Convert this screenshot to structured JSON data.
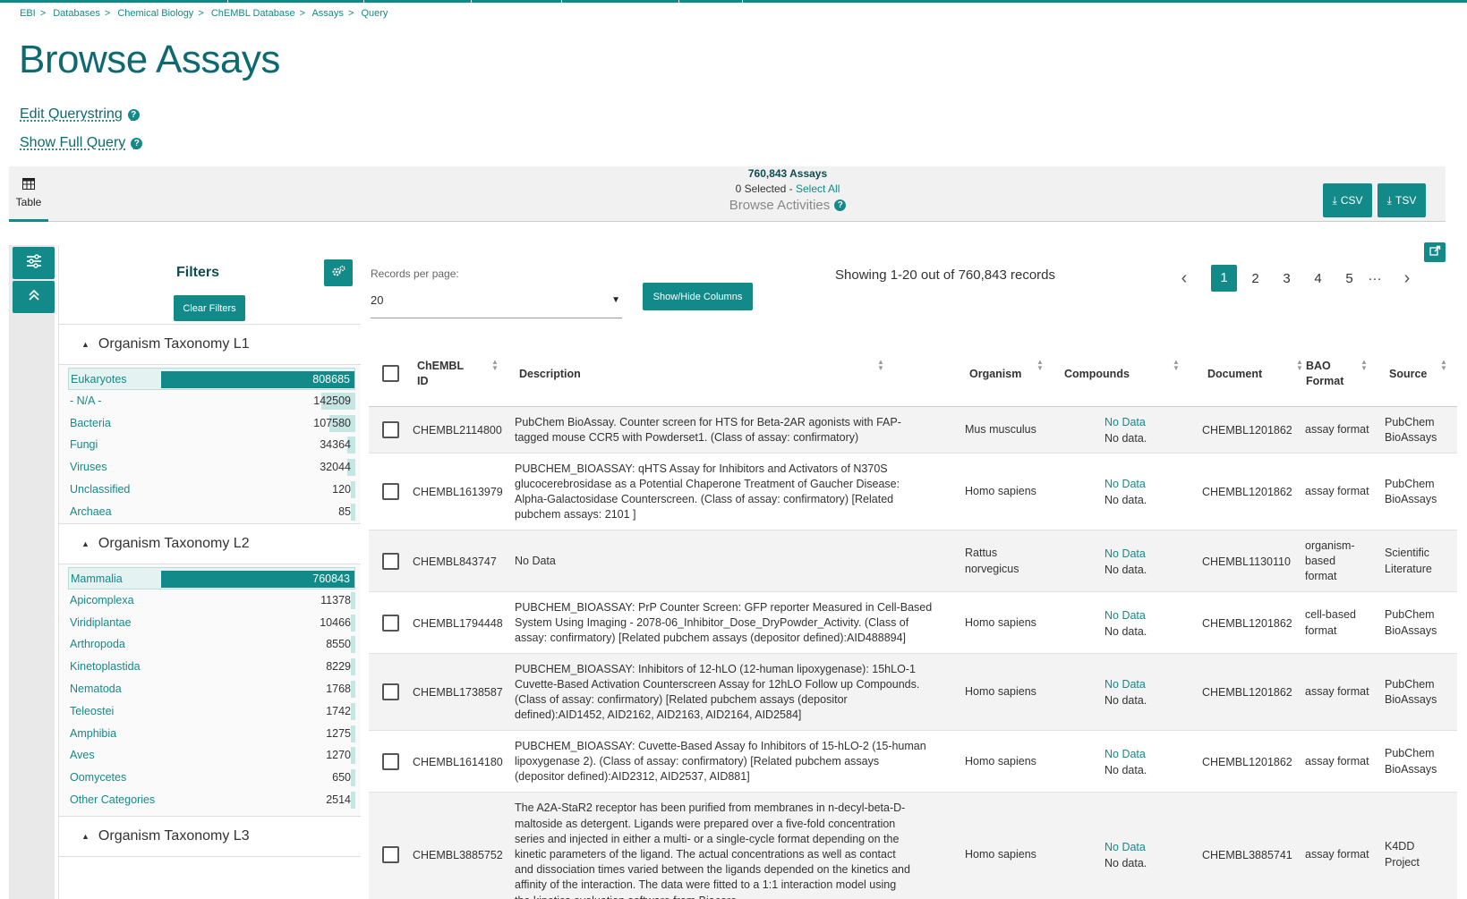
{
  "breadcrumb": [
    "EBI",
    "Databases",
    "Chemical Biology",
    "ChEMBL Database",
    "Assays",
    "Query"
  ],
  "page_title": "Browse Assays",
  "links": {
    "edit_query": "Edit Querystring",
    "show_query": "Show Full Query"
  },
  "view_tab": {
    "label": "Table",
    "icon": "table-icon"
  },
  "summary": {
    "count": "760,843 Assays",
    "selected": "0 Selected - ",
    "select_all": "Select All",
    "browse": "Browse Activities"
  },
  "downloads": {
    "csv": "CSV",
    "tsv": "TSV"
  },
  "filters": {
    "title": "Filters",
    "clear": "Clear Filters",
    "facets": [
      {
        "name": "Organism Taxonomy L1",
        "max": 808685,
        "items": [
          {
            "label": "Eukaryotes",
            "count": "808685",
            "value": 808685,
            "selected": true
          },
          {
            "label": "- N/A -",
            "count": "142509",
            "value": 142509
          },
          {
            "label": "Bacteria",
            "count": "107580",
            "value": 107580
          },
          {
            "label": "Fungi",
            "count": "34364",
            "value": 34364
          },
          {
            "label": "Viruses",
            "count": "32044",
            "value": 32044
          },
          {
            "label": "Unclassified",
            "count": "120",
            "value": 120
          },
          {
            "label": "Archaea",
            "count": "85",
            "value": 85
          }
        ]
      },
      {
        "name": "Organism Taxonomy L2",
        "max": 760843,
        "items": [
          {
            "label": "Mammalia",
            "count": "760843",
            "value": 760843,
            "selected": true
          },
          {
            "label": "Apicomplexa",
            "count": "11378",
            "value": 11378
          },
          {
            "label": "Viridiplantae",
            "count": "10466",
            "value": 10466
          },
          {
            "label": "Arthropoda",
            "count": "8550",
            "value": 8550
          },
          {
            "label": "Kinetoplastida",
            "count": "8229",
            "value": 8229
          },
          {
            "label": "Nematoda",
            "count": "1768",
            "value": 1768
          },
          {
            "label": "Teleostei",
            "count": "1742",
            "value": 1742
          },
          {
            "label": "Amphibia",
            "count": "1275",
            "value": 1275
          },
          {
            "label": "Aves",
            "count": "1270",
            "value": 1270
          },
          {
            "label": "Oomycetes",
            "count": "650",
            "value": 650
          },
          {
            "label": "Other Categories",
            "count": "2514",
            "value": 2514
          }
        ]
      },
      {
        "name": "Organism Taxonomy L3",
        "items": []
      }
    ]
  },
  "records": {
    "label": "Records per page:",
    "value": "20"
  },
  "columns_button": "Show/Hide Columns",
  "showing": "Showing 1-20 out of 760,843 records",
  "pagination": {
    "pages": [
      "1",
      "2",
      "3",
      "4",
      "5"
    ],
    "active": "1",
    "ellipsis": "···"
  },
  "table": {
    "headers": {
      "id": [
        "ChEMBL",
        "ID"
      ],
      "description": "Description",
      "organism": "Organism",
      "compounds": "Compounds",
      "document": "Document",
      "bao": [
        "BAO",
        "Format"
      ],
      "source": "Source"
    },
    "rows": [
      {
        "id": "CHEMBL2114800",
        "description": [
          "PubChem BioAssay. Counter screen for HTS for Beta-2AR agonists with FAP-",
          "tagged mouse CCR5 with Powderset1. (Class of assay: confirmatory)"
        ],
        "organism": [
          "Mus musculus"
        ],
        "compounds_link": "No Data",
        "compounds_text": "No data.",
        "document": "CHEMBL1201862",
        "bao": [
          "assay format"
        ],
        "source": [
          "PubChem",
          "BioAssays"
        ]
      },
      {
        "id": "CHEMBL1613979",
        "description": [
          "PUBCHEM_BIOASSAY: qHTS Assay for Inhibitors and Activators of N370S",
          "glucocerebrosidase as a Potential Chaperone Treatment of Gaucher Disease:",
          "Alpha-Galactosidase Counterscreen. (Class of assay: confirmatory) [Related",
          "pubchem assays: 2101 ]"
        ],
        "organism": [
          "Homo sapiens"
        ],
        "compounds_link": "No Data",
        "compounds_text": "No data.",
        "document": "CHEMBL1201862",
        "bao": [
          "assay format"
        ],
        "source": [
          "PubChem",
          "BioAssays"
        ]
      },
      {
        "id": "CHEMBL843747",
        "description": [
          "No Data"
        ],
        "organism": [
          "Rattus",
          "norvegicus"
        ],
        "compounds_link": "No Data",
        "compounds_text": "No data.",
        "document": "CHEMBL1130110",
        "bao": [
          "organism-",
          "based",
          "format"
        ],
        "source": [
          "Scientific",
          "Literature"
        ]
      },
      {
        "id": "CHEMBL1794448",
        "description": [
          "PUBCHEM_BIOASSAY: PrP Counter Screen: GFP reporter Measured in Cell-Based",
          "System Using Imaging - 2078-06_Inhibitor_Dose_DryPowder_Activity. (Class of",
          "assay: confirmatory) [Related pubchem assays (depositor defined):AID488894]"
        ],
        "organism": [
          "Homo sapiens"
        ],
        "compounds_link": "No Data",
        "compounds_text": "No data.",
        "document": "CHEMBL1201862",
        "bao": [
          "cell-based",
          "format"
        ],
        "source": [
          "PubChem",
          "BioAssays"
        ]
      },
      {
        "id": "CHEMBL1738587",
        "description": [
          "PUBCHEM_BIOASSAY: Inhibitors of 12-hLO (12-human lipoxygenase): 15hLO-1",
          "Cuvette-Based Activation Counterscreen Assay for 12hLO Follow up Compounds.",
          "(Class of assay: confirmatory) [Related pubchem assays (depositor",
          "defined):AID1452, AID2162, AID2163, AID2164, AID2584]"
        ],
        "organism": [
          "Homo sapiens"
        ],
        "compounds_link": "No Data",
        "compounds_text": "No data.",
        "document": "CHEMBL1201862",
        "bao": [
          "assay format"
        ],
        "source": [
          "PubChem",
          "BioAssays"
        ]
      },
      {
        "id": "CHEMBL1614180",
        "description": [
          "PUBCHEM_BIOASSAY: Cuvette-Based Assay fo Inhibitors of 15-hLO-2 (15-human",
          "lipoxygenase 2). (Class of assay: confirmatory) [Related pubchem assays",
          "(depositor defined):AID2312, AID2537, AID881]"
        ],
        "organism": [
          "Homo sapiens"
        ],
        "compounds_link": "No Data",
        "compounds_text": "No data.",
        "document": "CHEMBL1201862",
        "bao": [
          "assay format"
        ],
        "source": [
          "PubChem",
          "BioAssays"
        ]
      },
      {
        "id": "CHEMBL3885752",
        "description": [
          "The A2A-StaR2 receptor has been purified from membranes in n-decyl-beta-D-",
          "maltoside as detergent. Ligands were prepared over a five-fold concentration",
          "series and injected in either a multi- or a single-cycle format depending on the",
          "kinetic parameters of the ligand. The actual concentrations as well as contact",
          "and dissociation times varied between the ligands depended on the kinetics and",
          "affinity of the interaction. The data were fitted to a 1:1 interaction model using",
          "the kinetics evaluation software from Biacore."
        ],
        "organism": [
          "Homo sapiens"
        ],
        "compounds_link": "No Data",
        "compounds_text": "No data.",
        "document": "CHEMBL3885741",
        "bao": [
          "assay format"
        ],
        "source": [
          "K4DD",
          "Project"
        ]
      }
    ]
  }
}
